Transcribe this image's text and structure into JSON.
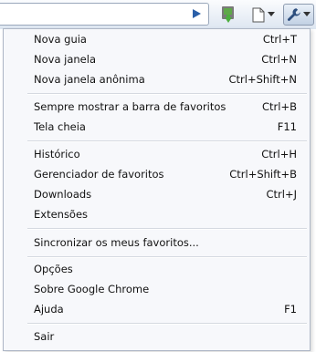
{
  "menu": {
    "items": [
      {
        "label": "Nova guia",
        "shortcut": "Ctrl+T"
      },
      {
        "label": "Nova janela",
        "shortcut": "Ctrl+N"
      },
      {
        "label": "Nova janela anônima",
        "shortcut": "Ctrl+Shift+N"
      },
      {
        "label": "Sempre mostrar a barra de favoritos",
        "shortcut": "Ctrl+B"
      },
      {
        "label": "Tela cheia",
        "shortcut": "F11"
      },
      {
        "label": "Histórico",
        "shortcut": "Ctrl+H"
      },
      {
        "label": "Gerenciador de favoritos",
        "shortcut": "Ctrl+Shift+B"
      },
      {
        "label": "Downloads",
        "shortcut": "Ctrl+J"
      },
      {
        "label": "Extensões",
        "shortcut": ""
      },
      {
        "label": "Sincronizar os meus favoritos...",
        "shortcut": ""
      },
      {
        "label": "Opções",
        "shortcut": ""
      },
      {
        "label": "Sobre Google Chrome",
        "shortcut": ""
      },
      {
        "label": "Ajuda",
        "shortcut": "F1"
      },
      {
        "label": "Sair",
        "shortcut": ""
      }
    ]
  },
  "colors": {
    "accent": "#2c5d9c",
    "menu_bg": "#f7f8fb"
  }
}
